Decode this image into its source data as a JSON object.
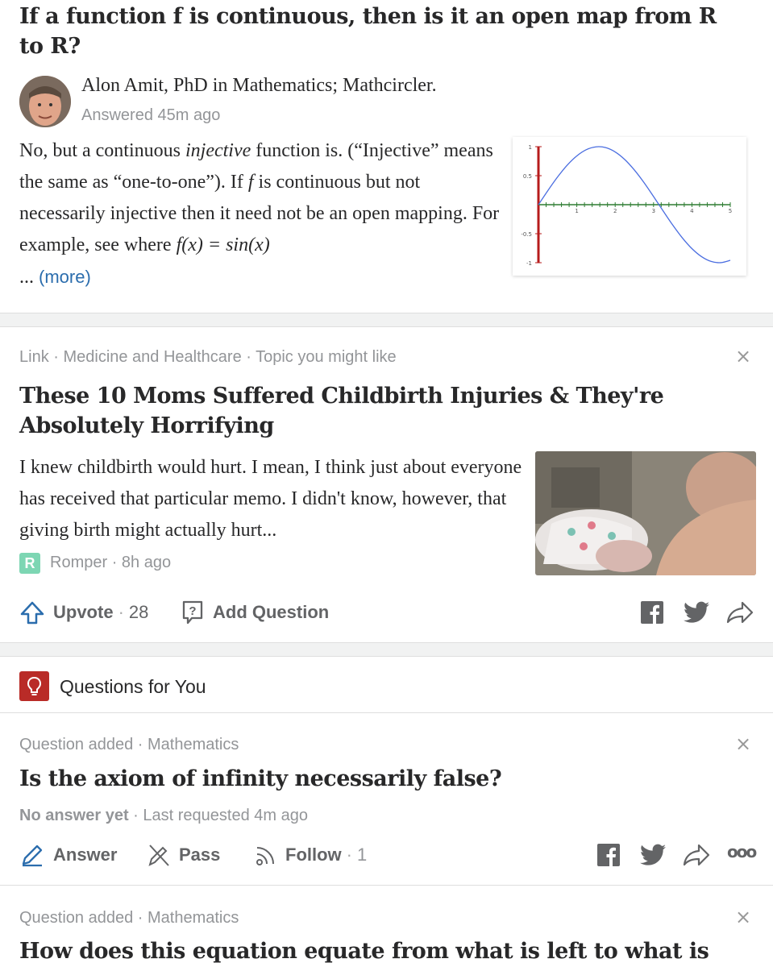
{
  "answer_card": {
    "question": "If a function f is continuous, then is it an open map from R to R?",
    "author": "Alon Amit, PhD in Mathematics; Mathcircler.",
    "answered": "Answered 45m ago",
    "body_1": "No, but a continuous ",
    "body_em": "injective",
    "body_2": " function is. (“Injective” means the same as “one-to-one”). If ",
    "body_f": "f",
    "body_3": " is continuous but not necessarily injective then it need not be an open mapping. For example, see where ",
    "body_math": "f(x) = sin(x)",
    "ellipsis": "...",
    "more": "(more)",
    "chart_data": {
      "type": "line",
      "x": [
        0,
        0.25,
        0.5,
        0.75,
        1,
        1.25,
        1.5,
        1.75,
        2,
        2.25,
        2.5,
        2.75,
        3,
        3.25,
        3.5,
        3.75,
        4,
        4.25,
        4.5,
        4.75,
        5
      ],
      "y": [
        0,
        0.247,
        0.479,
        0.682,
        0.841,
        0.949,
        0.997,
        0.984,
        0.909,
        0.778,
        0.598,
        0.382,
        0.141,
        -0.108,
        -0.351,
        -0.572,
        -0.757,
        -0.895,
        -0.978,
        -0.999,
        -0.959
      ],
      "xticks": [
        "1",
        "2",
        "3",
        "4",
        "5"
      ],
      "yticks": [
        "1",
        "0.5",
        "-0.5",
        "-1"
      ],
      "xlim": [
        0,
        5
      ],
      "ylim": [
        -1,
        1
      ],
      "colors": {
        "curve": "#4a6de0",
        "xaxis": "#2e7d32",
        "yaxis": "#b71c1c"
      }
    }
  },
  "link_card": {
    "meta": "Link · Medicine and Healthcare · Topic you might like",
    "close": "×",
    "title": "These 10 Moms Suffered Childbirth Injuries & They're Absolutely Horrifying",
    "body": "I knew childbirth would hurt. I mean, I think just about everyone has received that particular memo. I didn't know, however, that giving birth might actually hurt...",
    "source_icon_letter": "R",
    "source": "Romper · 8h ago",
    "upvote_label": "Upvote",
    "upvote_sep": "·",
    "upvote_count": "28",
    "add_question": "Add Question"
  },
  "questions_header": {
    "title": "Questions for You",
    "accent": "#b92b27"
  },
  "question_1": {
    "meta": "Question added · Mathematics",
    "close": "×",
    "title": "Is the axiom of infinity necessarily false?",
    "no_answer": "No answer yet",
    "requested": " · Last requested 4m ago",
    "answer": "Answer",
    "pass": "Pass",
    "follow": "Follow",
    "follow_sep": "·",
    "follow_count": "1",
    "more": "ooo"
  },
  "question_2": {
    "meta": "Question added · Mathematics",
    "close": "×",
    "title": "How does this equation equate from what is left to what is"
  }
}
